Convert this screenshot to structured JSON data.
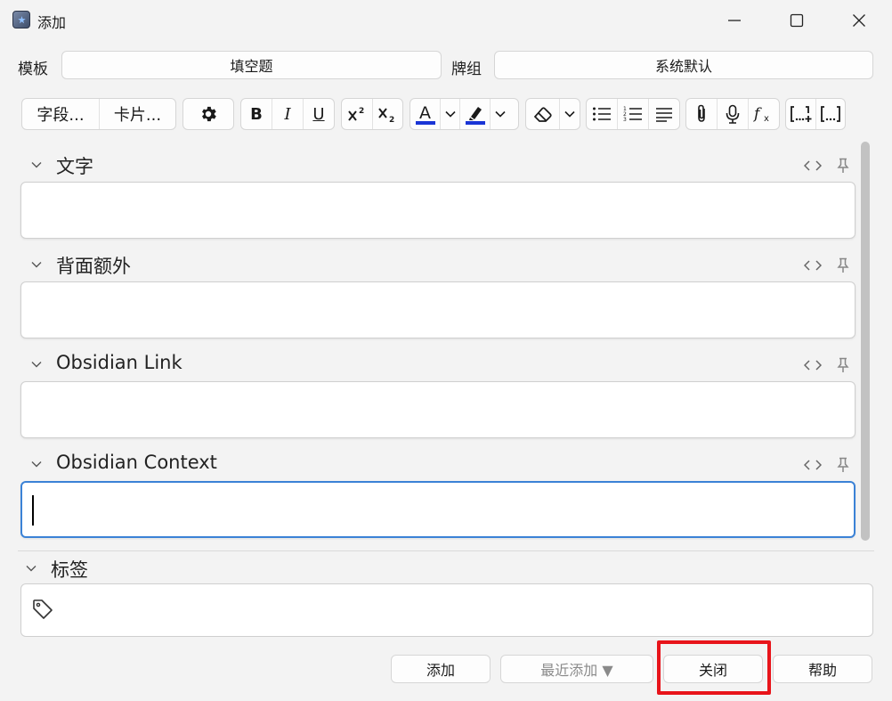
{
  "window": {
    "title": "添加"
  },
  "header": {
    "type_label": "模板",
    "type_value": "填空题",
    "deck_label": "牌组",
    "deck_value": "系统默认"
  },
  "toolbar": {
    "fields_label": "字段...",
    "cards_label": "卡片...",
    "bold": "B",
    "italic": "I",
    "underline": "U",
    "text_color_letter": "A",
    "text_color": "#1a35d6",
    "highlight_color": "#1a35d6"
  },
  "fields": [
    {
      "label": "文字",
      "value": ""
    },
    {
      "label": "背面额外",
      "value": ""
    },
    {
      "label": "Obsidian Link",
      "value": ""
    },
    {
      "label": "Obsidian Context",
      "value": ""
    }
  ],
  "tags": {
    "label": "标签",
    "value": ""
  },
  "buttons": {
    "add": "添加",
    "history": "最近添加 ▼",
    "close": "关闭",
    "help": "帮助"
  },
  "colors": {
    "focus_border": "#3b82d6",
    "highlight_box": "#e8141a"
  }
}
